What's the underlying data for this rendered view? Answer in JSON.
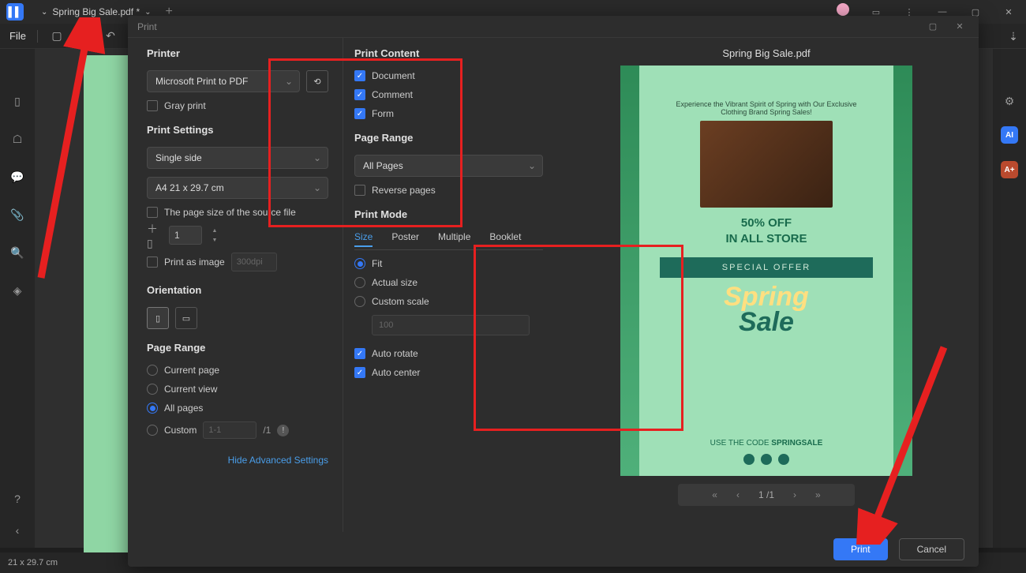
{
  "titlebar": {
    "filename": "Spring Big Sale.pdf *",
    "tab_dropdown_icon": "⌄",
    "plus_icon": "+"
  },
  "toolbar": {
    "file_label": "File"
  },
  "dialog": {
    "title": "Print",
    "preview_filename": "Spring Big Sale.pdf",
    "left": {
      "printer_label": "Printer",
      "printer_value": "Microsoft Print to PDF",
      "gray_print": "Gray print",
      "print_settings_label": "Print Settings",
      "sides": "Single side",
      "paper": "A4 21 x 29.7 cm",
      "source_size": "The page size of the source file",
      "copies_value": "1",
      "print_as_image": "Print as image",
      "dpi_placeholder": "300dpi",
      "orientation_label": "Orientation",
      "page_range_label": "Page Range",
      "range_current_page": "Current page",
      "range_current_view": "Current view",
      "range_all_pages": "All pages",
      "range_custom": "Custom",
      "range_custom_placeholder": "1-1",
      "range_total": "/1",
      "advanced_link": "Hide Advanced Settings"
    },
    "mid": {
      "print_content_label": "Print Content",
      "content_document": "Document",
      "content_comment": "Comment",
      "content_form": "Form",
      "page_range_label": "Page Range",
      "page_range_value": "All Pages",
      "reverse_pages": "Reverse pages",
      "print_mode_label": "Print Mode",
      "tabs": {
        "size": "Size",
        "poster": "Poster",
        "multiple": "Multiple",
        "booklet": "Booklet"
      },
      "mode_fit": "Fit",
      "mode_actual": "Actual size",
      "mode_custom": "Custom scale",
      "scale_placeholder": "100",
      "auto_rotate": "Auto rotate",
      "auto_center": "Auto center"
    },
    "preview": {
      "tagline": "Experience the Vibrant Spirit of Spring with Our Exclusive Clothing Brand Spring Sales!",
      "off": "50% OFF",
      "store": "IN ALL STORE",
      "special_offer": "SPECIAL OFFER",
      "spring": "Spring",
      "sale": "Sale",
      "code_prefix": "USE THE CODE",
      "code": "SPRINGSALE",
      "page_indicator": "1 /1"
    },
    "buttons": {
      "print": "Print",
      "cancel": "Cancel"
    }
  },
  "statusbar": {
    "dimensions": "21 x 29.7 cm"
  }
}
